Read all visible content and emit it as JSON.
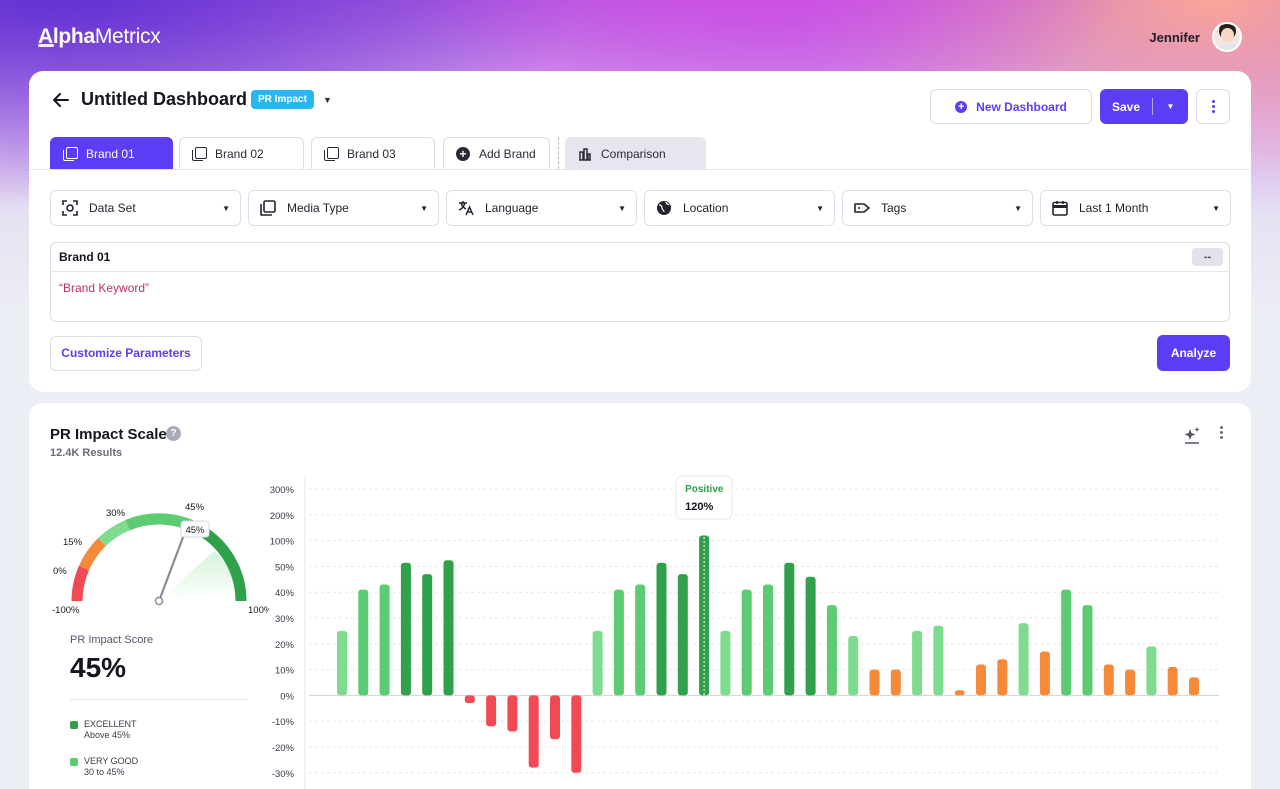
{
  "app": {
    "logo_bold": "Alpha",
    "logo_rest": "Metricx"
  },
  "user": {
    "name": "Jennifer"
  },
  "header": {
    "title": "Untitled Dashboard",
    "badge": "PR Impact",
    "new_dashboard": "New Dashboard",
    "save": "Save"
  },
  "tabs": [
    {
      "label": "Brand 01",
      "active": true
    },
    {
      "label": "Brand 02"
    },
    {
      "label": "Brand 03"
    },
    {
      "label": "Add Brand"
    },
    {
      "label": "Comparison"
    }
  ],
  "filters": [
    {
      "label": "Data Set",
      "icon": "scan-icon"
    },
    {
      "label": "Media Type",
      "icon": "copy-icon"
    },
    {
      "label": "Language",
      "icon": "translate-icon"
    },
    {
      "label": "Location",
      "icon": "globe-icon"
    },
    {
      "label": "Tags",
      "icon": "tag-icon"
    },
    {
      "label": "Last 1 Month",
      "icon": "calendar-icon"
    }
  ],
  "brand_box": {
    "title": "Brand 01",
    "collapse": "--",
    "keyword": "Brand Keyword"
  },
  "actions": {
    "customize": "Customize Parameters",
    "analyze": "Analyze"
  },
  "section": {
    "title": "PR Impact Scale",
    "help": "?",
    "results": "12.4K Results"
  },
  "gauge": {
    "labels": [
      "-100%",
      "0%",
      "15%",
      "30%",
      "45%",
      "100%"
    ],
    "pointer_label": "45%",
    "value": 45
  },
  "score": {
    "label": "PR Impact Score",
    "value": "45%"
  },
  "legend": [
    {
      "name": "EXCELLENT",
      "range": "Above 45%",
      "color": "#2ea14a"
    },
    {
      "name": "VERY GOOD",
      "range": "30 to 45%",
      "color": "#5ccc72"
    }
  ],
  "colors": {
    "accent": "#5b3df5",
    "dark_green": "#2ea14a",
    "green": "#5ccc72",
    "light_green": "#7fdb8e",
    "orange": "#f48a3a",
    "red": "#f04b55"
  },
  "chart_data": {
    "type": "bar",
    "y_ticks": [
      "300%",
      "200%",
      "100%",
      "50%",
      "40%",
      "30%",
      "20%",
      "10%",
      "0%",
      "-10%",
      "-20%",
      "-30%"
    ],
    "tooltip": {
      "label": "Positive",
      "value": "120%",
      "index": 17
    },
    "values": [
      25,
      41,
      43,
      57,
      47,
      62,
      -3,
      -12,
      -14,
      -28,
      -17,
      -33,
      25,
      41,
      43,
      57,
      47,
      120,
      25,
      41,
      43,
      57,
      46,
      35,
      23,
      10,
      10,
      25,
      27,
      2,
      12,
      14,
      28,
      17,
      41,
      35,
      12,
      10,
      19,
      11,
      7
    ],
    "colors": [
      "light",
      "green",
      "green",
      "dark",
      "dark",
      "dark",
      "red",
      "red",
      "red",
      "red",
      "red",
      "red",
      "light",
      "green",
      "green",
      "dark",
      "dark",
      "dark",
      "light",
      "green",
      "green",
      "dark",
      "dark",
      "green",
      "light",
      "orange",
      "orange",
      "light",
      "light",
      "orange",
      "orange",
      "orange",
      "light",
      "orange",
      "green",
      "green",
      "orange",
      "orange",
      "light",
      "orange",
      "orange"
    ]
  }
}
